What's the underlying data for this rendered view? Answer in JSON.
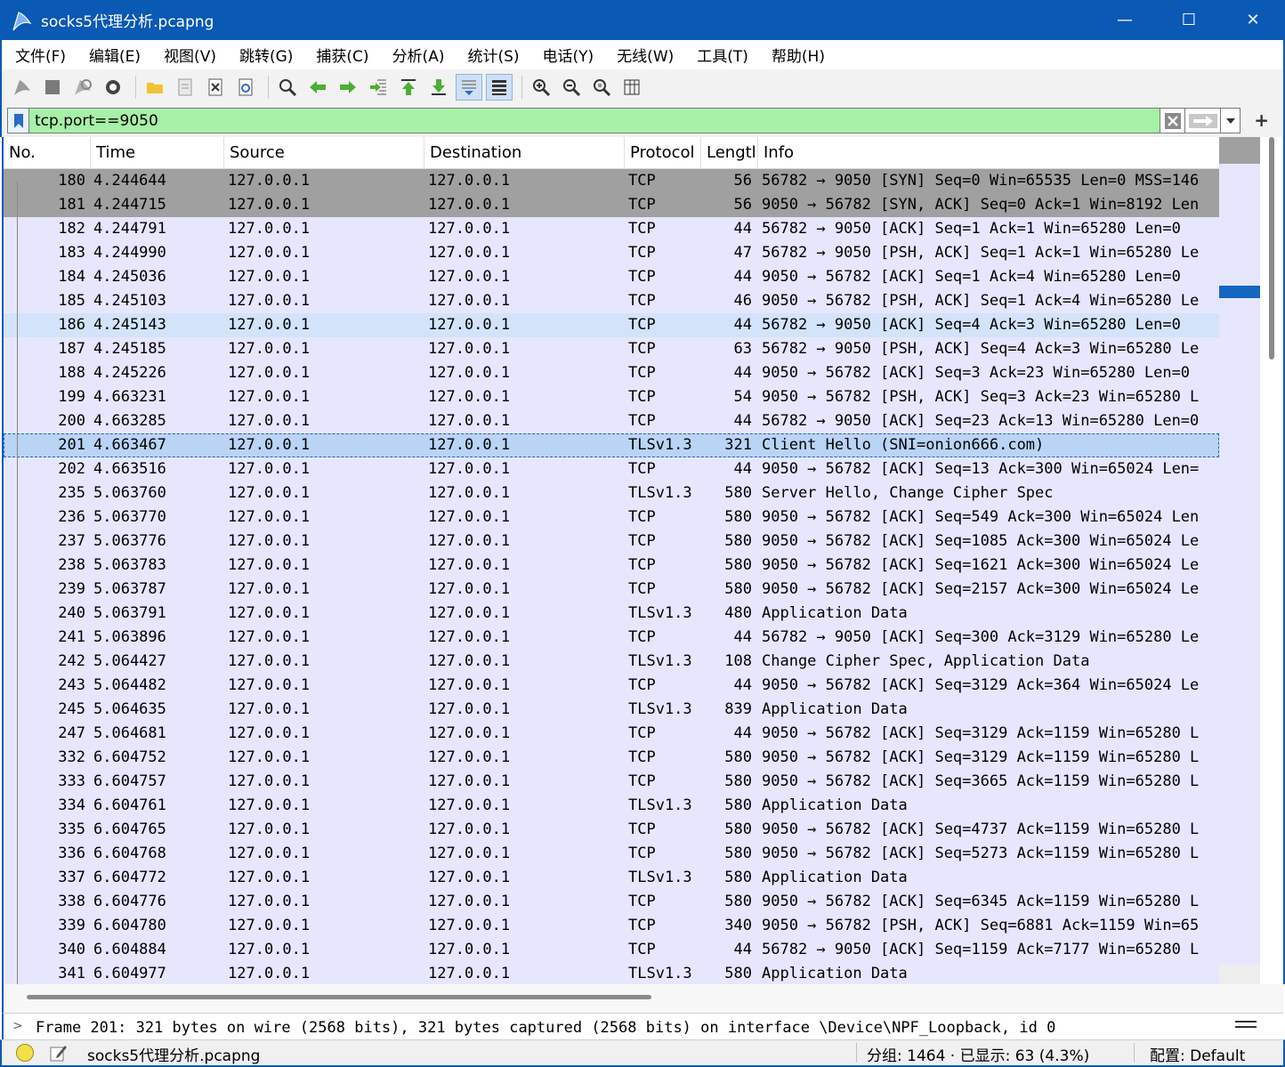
{
  "window": {
    "title": "socks5代理分析.pcapng",
    "minimize_label": "—",
    "maximize_label": "☐",
    "close_label": "✕"
  },
  "menu": [
    "文件(F)",
    "编辑(E)",
    "视图(V)",
    "跳转(G)",
    "捕获(C)",
    "分析(A)",
    "统计(S)",
    "电话(Y)",
    "无线(W)",
    "工具(T)",
    "帮助(H)"
  ],
  "toolbar": {
    "icons": [
      "shark-fin-start-icon",
      "stop-capture-icon",
      "restart-capture-icon",
      "capture-options-icon",
      "open-file-icon",
      "save-file-icon",
      "close-file-icon",
      "reload-file-icon",
      "find-packet-icon",
      "go-back-icon",
      "go-forward-icon",
      "go-to-packet-icon",
      "go-first-icon",
      "go-last-icon",
      "autoscroll-icon",
      "colorize-icon",
      "zoom-in-icon",
      "zoom-out-icon",
      "zoom-reset-icon",
      "resize-columns-icon"
    ]
  },
  "filter": {
    "value": "tcp.port==9050",
    "bg_color": "#a7f0a7"
  },
  "columns": [
    "No.",
    "Time",
    "Source",
    "Destination",
    "Protocol",
    "Lengtl",
    "Info"
  ],
  "packets": [
    {
      "no": "180",
      "time": "4.244644",
      "src": "127.0.0.1",
      "dst": "127.0.0.1",
      "proto": "TCP",
      "len": "56",
      "info": "56782 → 9050 [SYN] Seq=0 Win=65535 Len=0 MSS=146",
      "style": "syn"
    },
    {
      "no": "181",
      "time": "4.244715",
      "src": "127.0.0.1",
      "dst": "127.0.0.1",
      "proto": "TCP",
      "len": "56",
      "info": "9050 → 56782 [SYN, ACK] Seq=0 Ack=1 Win=8192 Len",
      "style": "syn"
    },
    {
      "no": "182",
      "time": "4.244791",
      "src": "127.0.0.1",
      "dst": "127.0.0.1",
      "proto": "TCP",
      "len": "44",
      "info": "56782 → 9050 [ACK] Seq=1 Ack=1 Win=65280 Len=0",
      "style": ""
    },
    {
      "no": "183",
      "time": "4.244990",
      "src": "127.0.0.1",
      "dst": "127.0.0.1",
      "proto": "TCP",
      "len": "47",
      "info": "56782 → 9050 [PSH, ACK] Seq=1 Ack=1 Win=65280 Le",
      "style": ""
    },
    {
      "no": "184",
      "time": "4.245036",
      "src": "127.0.0.1",
      "dst": "127.0.0.1",
      "proto": "TCP",
      "len": "44",
      "info": "9050 → 56782 [ACK] Seq=1 Ack=4 Win=65280 Len=0",
      "style": ""
    },
    {
      "no": "185",
      "time": "4.245103",
      "src": "127.0.0.1",
      "dst": "127.0.0.1",
      "proto": "TCP",
      "len": "46",
      "info": "9050 → 56782 [PSH, ACK] Seq=1 Ack=4 Win=65280 Le",
      "style": ""
    },
    {
      "no": "186",
      "time": "4.245143",
      "src": "127.0.0.1",
      "dst": "127.0.0.1",
      "proto": "TCP",
      "len": "44",
      "info": "56782 → 9050 [ACK] Seq=4 Ack=3 Win=65280 Len=0",
      "style": "hl"
    },
    {
      "no": "187",
      "time": "4.245185",
      "src": "127.0.0.1",
      "dst": "127.0.0.1",
      "proto": "TCP",
      "len": "63",
      "info": "56782 → 9050 [PSH, ACK] Seq=4 Ack=3 Win=65280 Le",
      "style": ""
    },
    {
      "no": "188",
      "time": "4.245226",
      "src": "127.0.0.1",
      "dst": "127.0.0.1",
      "proto": "TCP",
      "len": "44",
      "info": "9050 → 56782 [ACK] Seq=3 Ack=23 Win=65280 Len=0",
      "style": ""
    },
    {
      "no": "199",
      "time": "4.663231",
      "src": "127.0.0.1",
      "dst": "127.0.0.1",
      "proto": "TCP",
      "len": "54",
      "info": "9050 → 56782 [PSH, ACK] Seq=3 Ack=23 Win=65280 L",
      "style": ""
    },
    {
      "no": "200",
      "time": "4.663285",
      "src": "127.0.0.1",
      "dst": "127.0.0.1",
      "proto": "TCP",
      "len": "44",
      "info": "56782 → 9050 [ACK] Seq=23 Ack=13 Win=65280 Len=0",
      "style": ""
    },
    {
      "no": "201",
      "time": "4.663467",
      "src": "127.0.0.1",
      "dst": "127.0.0.1",
      "proto": "TLSv1.3",
      "len": "321",
      "info": "Client Hello (SNI=onion666.com)",
      "style": "sel"
    },
    {
      "no": "202",
      "time": "4.663516",
      "src": "127.0.0.1",
      "dst": "127.0.0.1",
      "proto": "TCP",
      "len": "44",
      "info": "9050 → 56782 [ACK] Seq=13 Ack=300 Win=65024 Len=",
      "style": ""
    },
    {
      "no": "235",
      "time": "5.063760",
      "src": "127.0.0.1",
      "dst": "127.0.0.1",
      "proto": "TLSv1.3",
      "len": "580",
      "info": "Server Hello, Change Cipher Spec",
      "style": ""
    },
    {
      "no": "236",
      "time": "5.063770",
      "src": "127.0.0.1",
      "dst": "127.0.0.1",
      "proto": "TCP",
      "len": "580",
      "info": "9050 → 56782 [ACK] Seq=549 Ack=300 Win=65024 Len",
      "style": ""
    },
    {
      "no": "237",
      "time": "5.063776",
      "src": "127.0.0.1",
      "dst": "127.0.0.1",
      "proto": "TCP",
      "len": "580",
      "info": "9050 → 56782 [ACK] Seq=1085 Ack=300 Win=65024 Le",
      "style": ""
    },
    {
      "no": "238",
      "time": "5.063783",
      "src": "127.0.0.1",
      "dst": "127.0.0.1",
      "proto": "TCP",
      "len": "580",
      "info": "9050 → 56782 [ACK] Seq=1621 Ack=300 Win=65024 Le",
      "style": ""
    },
    {
      "no": "239",
      "time": "5.063787",
      "src": "127.0.0.1",
      "dst": "127.0.0.1",
      "proto": "TCP",
      "len": "580",
      "info": "9050 → 56782 [ACK] Seq=2157 Ack=300 Win=65024 Le",
      "style": ""
    },
    {
      "no": "240",
      "time": "5.063791",
      "src": "127.0.0.1",
      "dst": "127.0.0.1",
      "proto": "TLSv1.3",
      "len": "480",
      "info": "Application Data",
      "style": ""
    },
    {
      "no": "241",
      "time": "5.063896",
      "src": "127.0.0.1",
      "dst": "127.0.0.1",
      "proto": "TCP",
      "len": "44",
      "info": "56782 → 9050 [ACK] Seq=300 Ack=3129 Win=65280 Le",
      "style": ""
    },
    {
      "no": "242",
      "time": "5.064427",
      "src": "127.0.0.1",
      "dst": "127.0.0.1",
      "proto": "TLSv1.3",
      "len": "108",
      "info": "Change Cipher Spec, Application Data",
      "style": ""
    },
    {
      "no": "243",
      "time": "5.064482",
      "src": "127.0.0.1",
      "dst": "127.0.0.1",
      "proto": "TCP",
      "len": "44",
      "info": "9050 → 56782 [ACK] Seq=3129 Ack=364 Win=65024 Le",
      "style": ""
    },
    {
      "no": "245",
      "time": "5.064635",
      "src": "127.0.0.1",
      "dst": "127.0.0.1",
      "proto": "TLSv1.3",
      "len": "839",
      "info": "Application Data",
      "style": ""
    },
    {
      "no": "247",
      "time": "5.064681",
      "src": "127.0.0.1",
      "dst": "127.0.0.1",
      "proto": "TCP",
      "len": "44",
      "info": "9050 → 56782 [ACK] Seq=3129 Ack=1159 Win=65280 L",
      "style": ""
    },
    {
      "no": "332",
      "time": "6.604752",
      "src": "127.0.0.1",
      "dst": "127.0.0.1",
      "proto": "TCP",
      "len": "580",
      "info": "9050 → 56782 [ACK] Seq=3129 Ack=1159 Win=65280 L",
      "style": ""
    },
    {
      "no": "333",
      "time": "6.604757",
      "src": "127.0.0.1",
      "dst": "127.0.0.1",
      "proto": "TCP",
      "len": "580",
      "info": "9050 → 56782 [ACK] Seq=3665 Ack=1159 Win=65280 L",
      "style": ""
    },
    {
      "no": "334",
      "time": "6.604761",
      "src": "127.0.0.1",
      "dst": "127.0.0.1",
      "proto": "TLSv1.3",
      "len": "580",
      "info": "Application Data",
      "style": ""
    },
    {
      "no": "335",
      "time": "6.604765",
      "src": "127.0.0.1",
      "dst": "127.0.0.1",
      "proto": "TCP",
      "len": "580",
      "info": "9050 → 56782 [ACK] Seq=4737 Ack=1159 Win=65280 L",
      "style": ""
    },
    {
      "no": "336",
      "time": "6.604768",
      "src": "127.0.0.1",
      "dst": "127.0.0.1",
      "proto": "TCP",
      "len": "580",
      "info": "9050 → 56782 [ACK] Seq=5273 Ack=1159 Win=65280 L",
      "style": ""
    },
    {
      "no": "337",
      "time": "6.604772",
      "src": "127.0.0.1",
      "dst": "127.0.0.1",
      "proto": "TLSv1.3",
      "len": "580",
      "info": "Application Data",
      "style": ""
    },
    {
      "no": "338",
      "time": "6.604776",
      "src": "127.0.0.1",
      "dst": "127.0.0.1",
      "proto": "TCP",
      "len": "580",
      "info": "9050 → 56782 [ACK] Seq=6345 Ack=1159 Win=65280 L",
      "style": ""
    },
    {
      "no": "339",
      "time": "6.604780",
      "src": "127.0.0.1",
      "dst": "127.0.0.1",
      "proto": "TCP",
      "len": "340",
      "info": "9050 → 56782 [PSH, ACK] Seq=6881 Ack=1159 Win=65",
      "style": ""
    },
    {
      "no": "340",
      "time": "6.604884",
      "src": "127.0.0.1",
      "dst": "127.0.0.1",
      "proto": "TCP",
      "len": "44",
      "info": "56782 → 9050 [ACK] Seq=1159 Ack=7177 Win=65280 L",
      "style": ""
    },
    {
      "no": "341",
      "time": "6.604977",
      "src": "127.0.0.1",
      "dst": "127.0.0.1",
      "proto": "TLSv1.3",
      "len": "580",
      "info": "Application Data",
      "style": ""
    }
  ],
  "details": {
    "frame_summary": "Frame 201: 321 bytes on wire (2568 bits), 321 bytes captured (2568 bits) on interface \\Device\\NPF_Loopback, id 0"
  },
  "status": {
    "file": "socks5代理分析.pcapng",
    "stats": "分组: 1464 · 已显示: 63 (4.3%)",
    "profile": "配置:  Default"
  },
  "colors": {
    "titlebar": "#0a59b4",
    "row_default": "#e7e6ff",
    "row_syn": "#a0a0a0",
    "row_selected": "#b9d4f4",
    "filter_valid": "#a7f0a7"
  }
}
